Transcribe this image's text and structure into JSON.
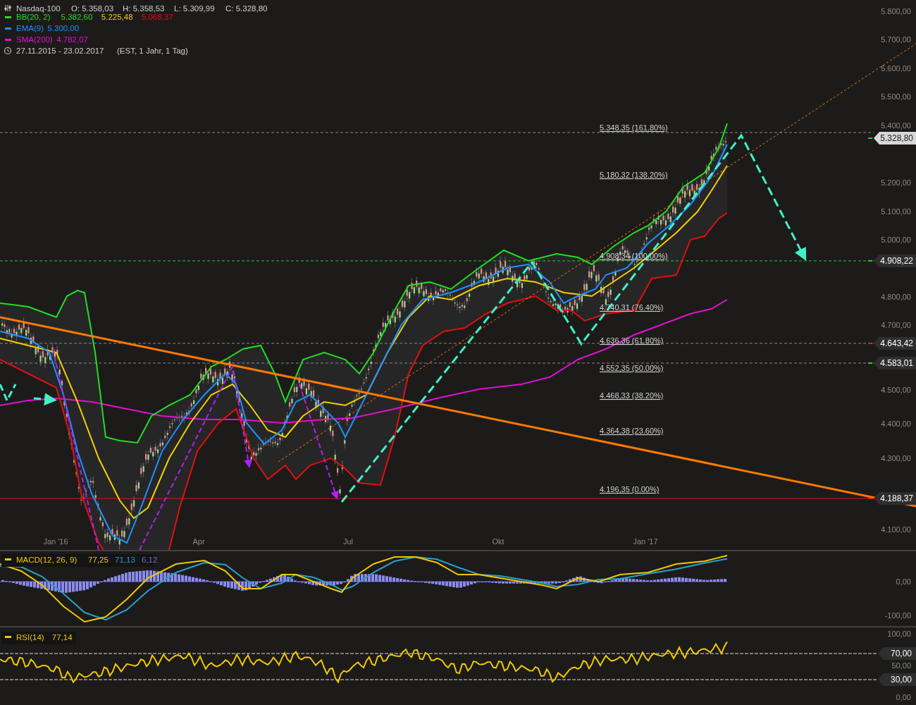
{
  "chart": {
    "legend": {
      "instrument": "Nasdaq-100",
      "ohlc": [
        "O: 5.358,03",
        "H: 5.358,53",
        "L: 5.309,99",
        "C: 5.328,80"
      ],
      "indicators": [
        {
          "name": "BB(20, 2)",
          "color": "#22dd22",
          "values": [
            {
              "text": "5.382,60",
              "color": "#22dd22"
            },
            {
              "text": "5.225,48",
              "color": "#f0d000"
            },
            {
              "text": "5.068,37",
              "color": "#e01010"
            }
          ]
        },
        {
          "name": "EMA(9)",
          "color": "#1e90ff",
          "values": [
            {
              "text": "5.300,00",
              "color": "#1e90ff"
            }
          ]
        },
        {
          "name": "SMA(200)",
          "color": "#e010d0",
          "values": [
            {
              "text": "4.782,07",
              "color": "#e010d0"
            }
          ]
        }
      ],
      "date_range": "27.11.2015 - 23.02.2017",
      "range_info": "(EST, 1 Jahr, 1 Tag)"
    },
    "price_axis": [
      "5.800,00",
      "5.700,00",
      "5.600,00",
      "5.500,00",
      "5.400,00",
      "5.200,00",
      "5.100,00",
      "5.000,00",
      "4.800,00",
      "4.700,00",
      "4.500,00",
      "4.400,00",
      "4.300,00",
      "4.100,00"
    ],
    "price_tags": [
      {
        "text": "5.328,80",
        "kind": "last",
        "color": "#22cc22"
      },
      {
        "text": "4.908,22",
        "kind": "level",
        "color": "#22cc22"
      },
      {
        "text": "4.643,42",
        "kind": "level",
        "color": "#dd2222"
      },
      {
        "text": "4.583,01",
        "kind": "level",
        "color": "#22cc22"
      },
      {
        "text": "4.188,37",
        "kind": "level",
        "color": "#dd2222"
      }
    ],
    "fib_levels": [
      "5.348,35 (161.80%)",
      "5.180,32 (138.20%)",
      "4.908,34 (100.00%)",
      "4.740,31 (76.40%)",
      "4.636,36 (61.80%)",
      "4.552,35 (50.00%)",
      "4.468,33 (38.20%)",
      "4.364,38 (23.60%)",
      "4.196,35 (0.00%)"
    ],
    "time_axis": [
      "Jan '16",
      "Apr",
      "Jul",
      "Okt",
      "Jan '17"
    ]
  },
  "macd": {
    "label": "MACD(12, 26, 9)",
    "color": "#f0c800",
    "values": [
      {
        "text": "77,25"
      },
      {
        "text": "71,13",
        "color": "#2aa0c8"
      },
      {
        "text": "6,12",
        "color": "#6a6ad0"
      }
    ],
    "axis": [
      "0,00",
      "-100,00"
    ]
  },
  "rsi": {
    "label": "RSI(14)",
    "color": "#f0c800",
    "values": [
      {
        "text": "77,14",
        "color": "#f0c800"
      }
    ],
    "axis": [
      "100,00",
      "50,00",
      "0,00"
    ],
    "tags": [
      "70,00",
      "30,00"
    ]
  }
}
